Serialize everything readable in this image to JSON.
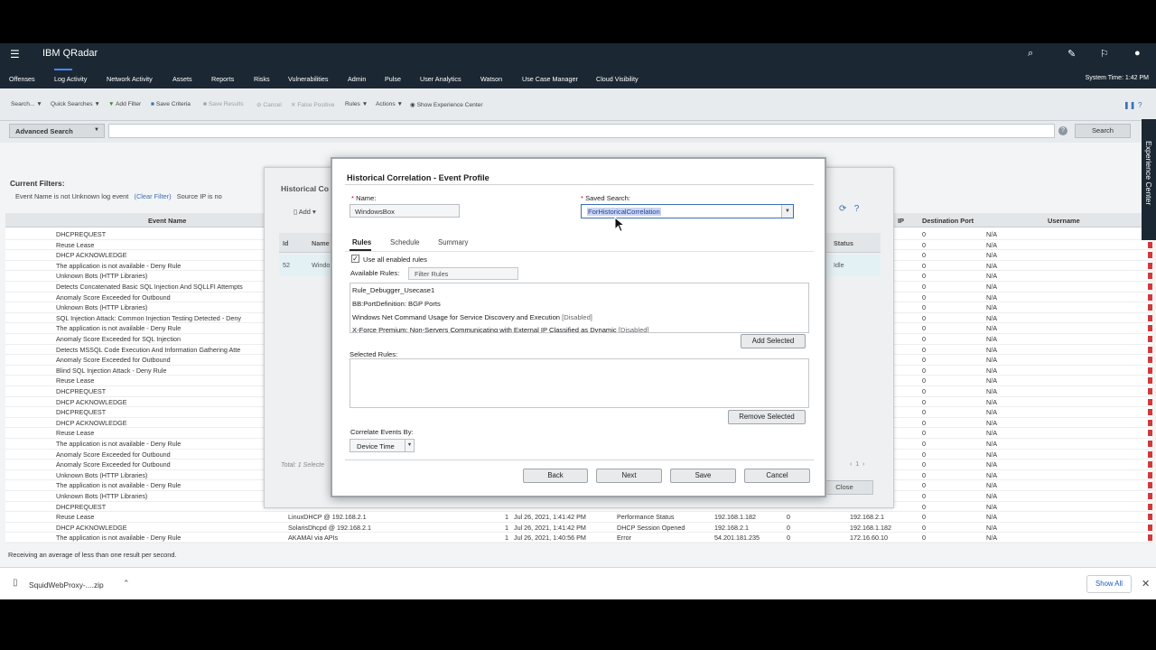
{
  "header": {
    "app_title": "IBM QRadar",
    "system_time": "System Time: 1:42 PM"
  },
  "nav": {
    "items": [
      "Offenses",
      "Log Activity",
      "Network Activity",
      "Assets",
      "Reports",
      "Risks",
      "Vulnerabilities",
      "Admin",
      "Pulse",
      "User Analytics",
      "Watson",
      "Use Case Manager",
      "Cloud Visibility"
    ],
    "active": "Log Activity"
  },
  "toolbar": {
    "search": "Search... ▼",
    "quick_searches": "Quick Searches ▼",
    "add_filter": "Add Filter",
    "save_criteria": "Save Criteria",
    "save_results": "Save Results",
    "cancel": "Cancel",
    "false_positive": "False Positive",
    "rules": "Rules ▼",
    "actions": "Actions ▼",
    "show_experience_center": "Show Experience Center"
  },
  "advanced": {
    "select_label": "Advanced Search",
    "search_button": "Search",
    "help": "?"
  },
  "filters": {
    "heading": "Current Filters:",
    "event_filter": "Event Name is not Unknown log event",
    "clear": "(Clear Filter)",
    "source_filter": "Source IP is no"
  },
  "events_table": {
    "headers": {
      "event_name": "Event Name",
      "ip": "IP",
      "destination_port": "Destination Port",
      "username": "Username"
    },
    "rows": [
      {
        "name": "DHCPREQUEST",
        "port": "0",
        "user": "N/A"
      },
      {
        "name": "Reuse Lease",
        "port": "0",
        "user": "N/A"
      },
      {
        "name": "DHCP ACKNOWLEDGE",
        "port": "0",
        "user": "N/A"
      },
      {
        "name": "The application is not available - Deny Rule",
        "port": "0",
        "user": "N/A"
      },
      {
        "name": "Unknown Bots (HTTP Libraries)",
        "port": "0",
        "user": "N/A"
      },
      {
        "name": "Detects Concatenated Basic SQL Injection And SQLLFI Attempts",
        "port": "0",
        "user": "N/A"
      },
      {
        "name": "Anomaly Score Exceeded for Outbound",
        "port": "0",
        "user": "N/A"
      },
      {
        "name": "Unknown Bots (HTTP Libraries)",
        "port": "0",
        "user": "N/A"
      },
      {
        "name": "SQL Injection Attack: Common Injection Testing Detected - Deny",
        "port": "0",
        "user": "N/A"
      },
      {
        "name": "The application is not available - Deny Rule",
        "port": "0",
        "user": "N/A"
      },
      {
        "name": "Anomaly Score Exceeded for SQL Injection",
        "port": "0",
        "user": "N/A"
      },
      {
        "name": "Detects MSSQL Code Execution And Information Gathering Atte",
        "port": "0",
        "user": "N/A"
      },
      {
        "name": "Anomaly Score Exceeded for Outbound",
        "port": "0",
        "user": "N/A"
      },
      {
        "name": "Blind SQL Injection Attack - Deny Rule",
        "port": "0",
        "user": "N/A"
      },
      {
        "name": "Reuse Lease",
        "port": "0",
        "user": "N/A"
      },
      {
        "name": "DHCPREQUEST",
        "port": "0",
        "user": "N/A"
      },
      {
        "name": "DHCP ACKNOWLEDGE",
        "port": "0",
        "user": "N/A"
      },
      {
        "name": "DHCPREQUEST",
        "port": "0",
        "user": "N/A"
      },
      {
        "name": "DHCP ACKNOWLEDGE",
        "port": "0",
        "user": "N/A"
      },
      {
        "name": "Reuse Lease",
        "port": "0",
        "user": "N/A"
      },
      {
        "name": "The application is not available - Deny Rule",
        "port": "0",
        "user": "N/A"
      },
      {
        "name": "Anomaly Score Exceeded for Outbound",
        "port": "0",
        "user": "N/A"
      },
      {
        "name": "Anomaly Score Exceeded for Outbound",
        "port": "0",
        "user": "N/A"
      },
      {
        "name": "Unknown Bots (HTTP Libraries)",
        "port": "0",
        "user": "N/A"
      },
      {
        "name": "The application is not available - Deny Rule",
        "port": "0",
        "user": "N/A"
      },
      {
        "name": "Unknown Bots (HTTP Libraries)",
        "port": "0",
        "user": "N/A"
      },
      {
        "name": "DHCPREQUEST",
        "port": "0",
        "user": "N/A"
      }
    ],
    "full_rows": [
      {
        "name": "Reuse Lease",
        "source": "LinuxDHCP @ 192.168.2.1",
        "count": "1",
        "time": "Jul 26, 2021, 1:41:42 PM",
        "category": "Performance Status",
        "src_ip": "192.168.1.182",
        "src_port": "0",
        "dst_ip": "192.168.2.1",
        "port": "0",
        "user": "N/A"
      },
      {
        "name": "DHCP ACKNOWLEDGE",
        "source": "SolarisDhcpd @ 192.168.2.1",
        "count": "1",
        "time": "Jul 26, 2021, 1:41:42 PM",
        "category": "DHCP Session Opened",
        "src_ip": "192.168.2.1",
        "src_port": "0",
        "dst_ip": "192.168.1.182",
        "port": "0",
        "user": "N/A"
      },
      {
        "name": "The application is not available - Deny Rule",
        "source": "AKAMAI via APIs",
        "count": "1",
        "time": "Jul 26, 2021, 1:40:56 PM",
        "category": "Error",
        "src_ip": "54.201.181.235",
        "src_port": "0",
        "dst_ip": "172.16.60.10",
        "port": "0",
        "user": "N/A"
      }
    ],
    "status_line": "Receiving an average of less than one result per second."
  },
  "bg_dialog": {
    "title": "Historical Co",
    "add": "Add",
    "col_id": "Id",
    "col_name": "Name",
    "col_status": "Status",
    "row_id": "52",
    "row_name": "Windo",
    "row_status": "Idle",
    "total": "Total: 1 Selecte",
    "page": "1",
    "close": "Close"
  },
  "modal": {
    "title": "Historical Correlation - Event Profile",
    "name_label": "Name:",
    "name_value": "WindowsBox",
    "saved_search_label": "Saved Search:",
    "saved_search_value": "ForHistoricalCorrelation",
    "tabs": [
      "Rules",
      "Schedule",
      "Summary"
    ],
    "use_all_label": "Use all enabled rules",
    "available_rules_label": "Available Rules:",
    "filter_placeholder": "Filter Rules",
    "available_rules": [
      {
        "name": "Rule_Debugger_Usecase1",
        "tag": ""
      },
      {
        "name": "BB:PortDefinition: BGP Ports",
        "tag": ""
      },
      {
        "name": "Windows Net Command Usage for Service Discovery and Execution",
        "tag": "[Disabled]"
      },
      {
        "name": "X-Force Premium: Non-Servers Communicating with External IP Classified as Dynamic",
        "tag": "[Disabled]"
      }
    ],
    "add_selected": "Add Selected",
    "selected_rules_label": "Selected Rules:",
    "remove_selected": "Remove Selected",
    "correlate_label": "Correlate Events By:",
    "correlate_value": "Device Time",
    "back": "Back",
    "next": "Next",
    "save": "Save",
    "cancel": "Cancel"
  },
  "side_tab": "Experience Center",
  "download_bar": {
    "file_name": "SquidWebProxy-....zip",
    "show_all": "Show All"
  }
}
